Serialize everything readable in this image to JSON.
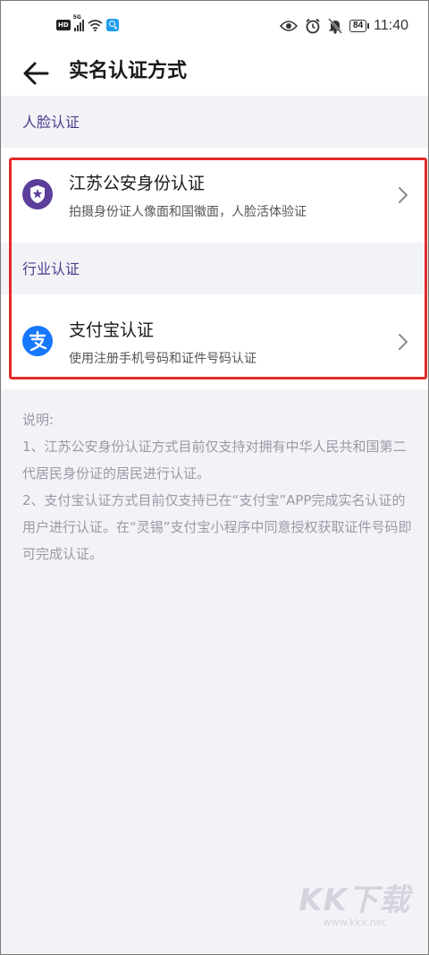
{
  "status_bar": {
    "hd_badge": "HD",
    "network": "5G",
    "battery": "84",
    "time": "11:40",
    "icons": [
      "hd-icon",
      "signal-icon",
      "wifi-icon",
      "search-app-icon",
      "eye-icon",
      "alarm-icon",
      "bell-muted-icon",
      "battery-icon"
    ]
  },
  "header": {
    "title": "实名认证方式",
    "back_icon": "arrow-left-icon"
  },
  "sections": [
    {
      "label": "人脸认证",
      "item": {
        "title": "江苏公安身份认证",
        "description": "拍摄身份证人像面和国徽面，人脸活体验证",
        "icon": "police-badge-icon",
        "icon_color": "#5b3e9a"
      }
    },
    {
      "label": "行业认证",
      "item": {
        "title": "支付宝认证",
        "description": "使用注册手机号码和证件号码认证",
        "icon": "alipay-icon",
        "icon_color": "#1677ff"
      }
    }
  ],
  "notes": {
    "heading": "说明:",
    "lines": [
      "1、江苏公安身份认证方式目前仅支持对拥有中华人民共和国第二代居民身份证的居民进行认证。",
      "2、支付宝认证方式目前仅支持已在“支付宝”APP完成实名认证的用户进行认证。在“灵锡”支付宝小程序中同意授权获取证件号码即可完成认证。"
    ]
  },
  "watermark": {
    "main": "KK下载",
    "url": "www.kkx.net"
  },
  "colors": {
    "section_label": "#4a3e8a",
    "highlight_border": "#e32a2a",
    "background": "#f2f3f7"
  }
}
